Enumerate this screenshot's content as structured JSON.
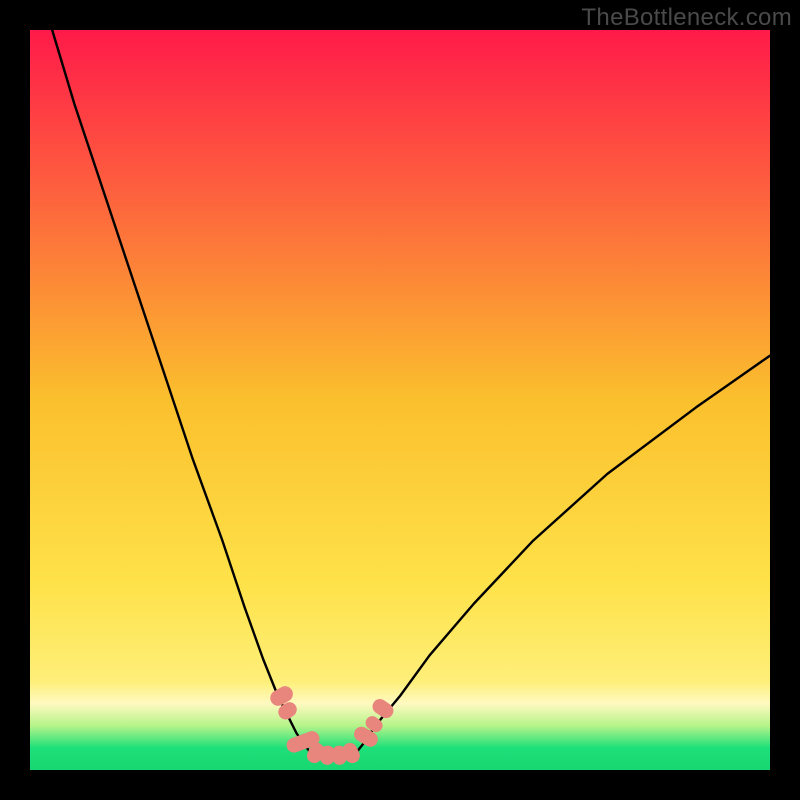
{
  "watermark": "TheBottleneck.com",
  "chart_data": {
    "type": "line",
    "title": "",
    "xlabel": "",
    "ylabel": "",
    "xlim": [
      0,
      100
    ],
    "ylim": [
      0,
      100
    ],
    "background": {
      "description": "vertical gradient from red-pink at top through orange, yellow, to green at bottom, with a brighter yellow-white band near y≈8 and thin green strip at y≈3",
      "stops": [
        {
          "y": 100,
          "color": "#ff1a49"
        },
        {
          "y": 75,
          "color": "#fd6b3c"
        },
        {
          "y": 50,
          "color": "#fbc02d"
        },
        {
          "y": 25,
          "color": "#fee24a"
        },
        {
          "y": 12,
          "color": "#feef79"
        },
        {
          "y": 9,
          "color": "#fff9c0"
        },
        {
          "y": 6,
          "color": "#b6f48a"
        },
        {
          "y": 3,
          "color": "#1ee07a"
        },
        {
          "y": 0,
          "color": "#16d770"
        }
      ]
    },
    "series": [
      {
        "name": "left-arm",
        "stroke": "#000000",
        "x": [
          3,
          6,
          10,
          14,
          18,
          22,
          26,
          29,
          31.5,
          33.5,
          35,
          36,
          37,
          37.8
        ],
        "y": [
          100,
          90,
          78,
          66,
          54,
          42,
          31,
          22,
          15,
          10,
          7,
          5,
          3.5,
          2.5
        ]
      },
      {
        "name": "right-arm",
        "stroke": "#000000",
        "x": [
          44.2,
          45,
          46,
          47.5,
          50,
          54,
          60,
          68,
          78,
          90,
          100
        ],
        "y": [
          2.5,
          3.5,
          5,
          7,
          10,
          15.5,
          22.5,
          31,
          40,
          49,
          56
        ]
      },
      {
        "name": "valley-floor",
        "stroke": "#000000",
        "x": [
          37.8,
          39,
          40.5,
          42,
          43,
          44.2
        ],
        "y": [
          2.5,
          2.0,
          1.8,
          1.8,
          2.0,
          2.5
        ]
      }
    ],
    "markers": {
      "name": "valley-beads",
      "fill": "#e8857d",
      "stroke": "#e8857d",
      "shape": "rounded-rect",
      "points": [
        {
          "x": 34.0,
          "y": 10.0,
          "w": 2.1,
          "h": 3.2,
          "rot": 60
        },
        {
          "x": 34.8,
          "y": 8.0,
          "w": 2.0,
          "h": 2.6,
          "rot": 55
        },
        {
          "x": 36.9,
          "y": 3.8,
          "w": 2.0,
          "h": 4.6,
          "rot": 70
        },
        {
          "x": 38.6,
          "y": 2.3,
          "w": 2.0,
          "h": 2.8,
          "rot": 25
        },
        {
          "x": 40.2,
          "y": 2.0,
          "w": 2.0,
          "h": 2.6,
          "rot": 5
        },
        {
          "x": 41.8,
          "y": 2.0,
          "w": 2.0,
          "h": 2.6,
          "rot": -5
        },
        {
          "x": 43.4,
          "y": 2.3,
          "w": 2.0,
          "h": 2.8,
          "rot": -25
        },
        {
          "x": 45.4,
          "y": 4.5,
          "w": 2.0,
          "h": 3.4,
          "rot": -60
        },
        {
          "x": 46.5,
          "y": 6.2,
          "w": 1.8,
          "h": 2.4,
          "rot": -55
        },
        {
          "x": 47.7,
          "y": 8.3,
          "w": 2.0,
          "h": 3.0,
          "rot": -55
        }
      ]
    }
  }
}
